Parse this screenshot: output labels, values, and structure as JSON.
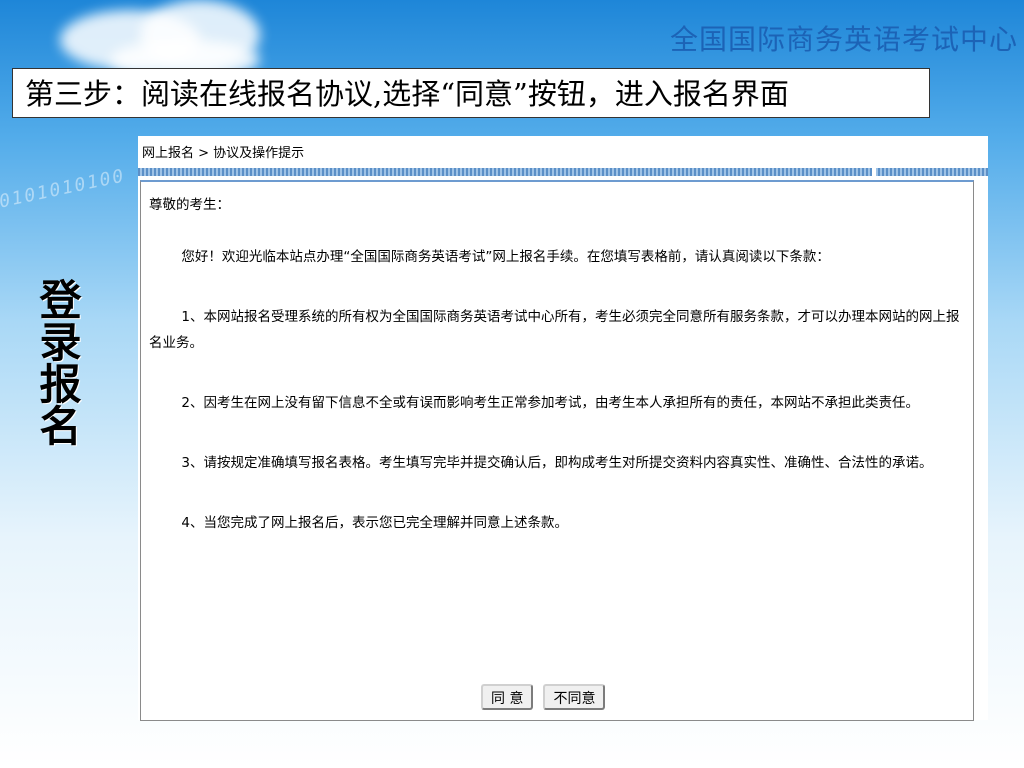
{
  "header": {
    "org_title": "全国国际商务英语考试中心"
  },
  "step": {
    "text": "第三步：阅读在线报名协议,选择“同意”按钮，进入报名界面"
  },
  "side": {
    "label": "登录报名"
  },
  "panel": {
    "breadcrumb": "网上报名 > 协议及操作提示",
    "greeting": "尊敬的考生：",
    "paragraphs": [
      "您好！欢迎光临本站点办理“全国国际商务英语考试”网上报名手续。在您填写表格前，请认真阅读以下条款：",
      "1、本网站报名受理系统的所有权为全国国际商务英语考试中心所有，考生必须完全同意所有服务条款，才可以办理本网站的网上报名业务。",
      "2、因考生在网上没有留下信息不全或有误而影响考生正常参加考试，由考生本人承担所有的责任，本网站不承担此类责任。",
      "3、请按规定准确填写报名表格。考生填写完毕并提交确认后，即构成考生对所提交资料内容真实性、准确性、合法性的承诺。",
      "4、当您完成了网上报名后，表示您已完全理解并同意上述条款。"
    ],
    "buttons": {
      "agree": "同 意",
      "disagree": "不同意"
    }
  },
  "decor": {
    "binary": "0101010100"
  },
  "colors": {
    "title_blue": "#1c63b6",
    "sky_blue": "#1e86d8",
    "stripe_blue": "#5b8fc7"
  }
}
